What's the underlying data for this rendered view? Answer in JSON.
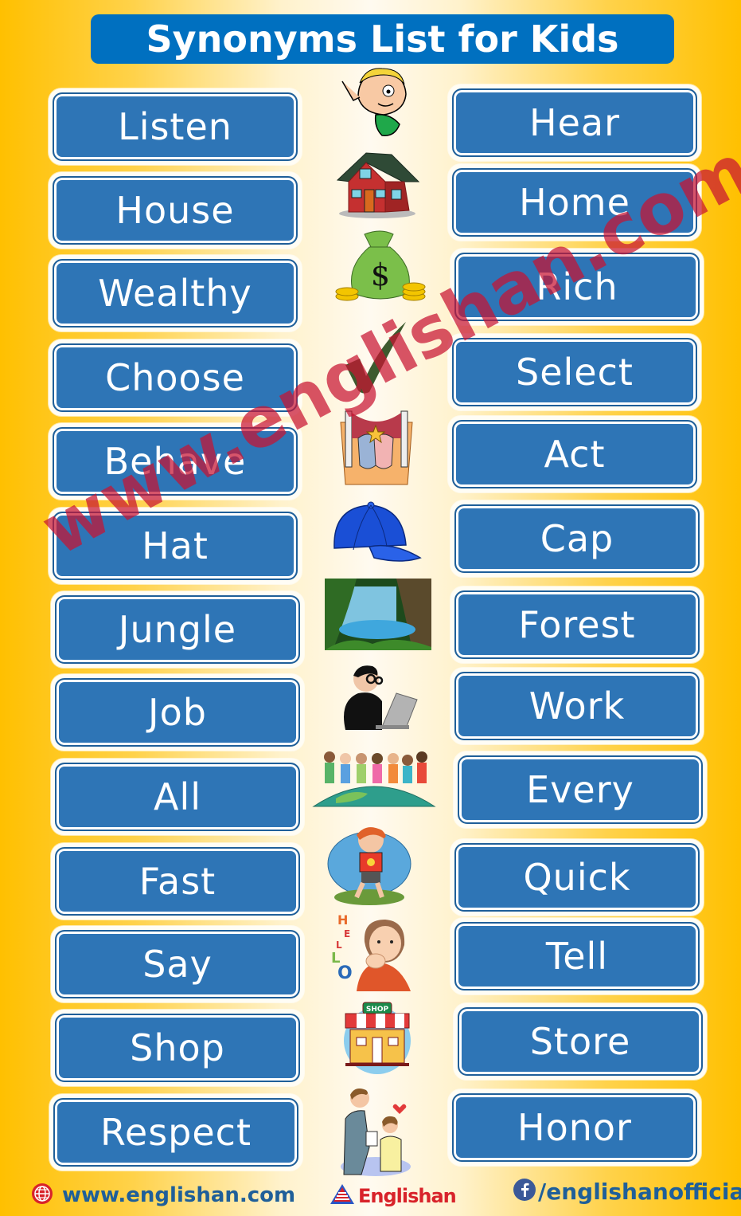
{
  "title": "Synonyms List for Kids",
  "colors": {
    "background_edge": "#ffc000",
    "background_center": "#fffaf0",
    "title_bar": "#0070c0",
    "card_fill": "#2e75b6",
    "card_text": "#ffffff",
    "watermark": "#c81432",
    "footer_text": "#1f5f99",
    "logo_red": "#d8232a"
  },
  "pairs": [
    {
      "word": "Listen",
      "synonym": "Hear",
      "icon": "listening-boy-icon"
    },
    {
      "word": "House",
      "synonym": "Home",
      "icon": "house-icon"
    },
    {
      "word": "Wealthy",
      "synonym": "Rich",
      "icon": "money-bag-icon"
    },
    {
      "word": "Choose",
      "synonym": "Select",
      "icon": "checkmark-icon"
    },
    {
      "word": "Behave",
      "synonym": "Act",
      "icon": "theater-masks-icon"
    },
    {
      "word": "Hat",
      "synonym": "Cap",
      "icon": "baseball-cap-icon"
    },
    {
      "word": "Jungle",
      "synonym": "Forest",
      "icon": "jungle-scene-icon"
    },
    {
      "word": "Job",
      "synonym": "Work",
      "icon": "office-worker-icon"
    },
    {
      "word": "All",
      "synonym": "Every",
      "icon": "children-on-globe-icon"
    },
    {
      "word": "Fast",
      "synonym": "Quick",
      "icon": "running-girl-icon"
    },
    {
      "word": "Say",
      "synonym": "Tell",
      "icon": "girl-saying-hello-icon"
    },
    {
      "word": "Shop",
      "synonym": "Store",
      "icon": "shop-building-icon"
    },
    {
      "word": "Respect",
      "synonym": "Honor",
      "icon": "handshake-respect-icon"
    }
  ],
  "shop_sign": "SHOP",
  "hello_letters": "HELLO",
  "watermark": "www.englishan.com",
  "footer": {
    "website": "www.englishan.com",
    "brand": "Englishan",
    "facebook": "/englishanofficial"
  }
}
